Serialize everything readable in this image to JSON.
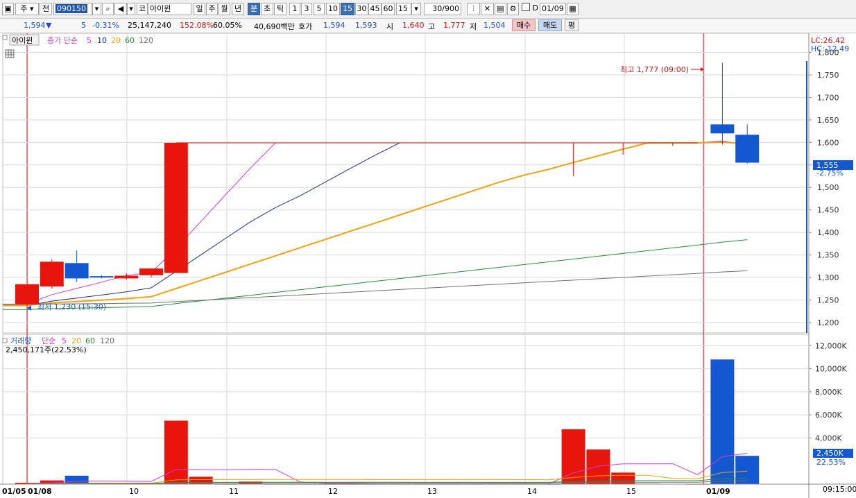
{
  "toolbar": {
    "market_type": "주",
    "market_arrow": "▾",
    "prev_label": "전",
    "stock_code": "090150",
    "dropdown_glyph": "▾",
    "market_tag": "코",
    "stock_name": "아이윈",
    "periods": [
      "일",
      "주",
      "월",
      "년",
      "분",
      "초",
      "틱"
    ],
    "active_period": "분",
    "intervals": [
      "1",
      "3",
      "5",
      "10",
      "15",
      "30",
      "45",
      "60"
    ],
    "active_interval": "15",
    "interval_select": "15",
    "count_value": "30",
    "count_total": "/900",
    "checkbox_label": "D",
    "date_value": "01/09",
    "icons": [
      "chart-type-icon",
      "search-icon",
      "speaker-icon",
      "candle-tool-icon",
      "eraser-tool-icon",
      "save-icon",
      "gear-icon",
      "calendar-icon"
    ]
  },
  "quote": {
    "price": "1,594",
    "down_arrow": "▼",
    "change": "5",
    "change_pct": "-0.31%",
    "volume": "25,147,240",
    "volume_ratio": "152.08%",
    "turnover_pct": "60.05%",
    "trade_value": "40,690백만",
    "bid_ask_label": "호가",
    "ask": "1,594",
    "bid": "1,593",
    "open_label": "시",
    "open": "1,640",
    "high_label": "고",
    "high": "1,777",
    "low_label": "저",
    "low": "1,504",
    "buy_label": "매수",
    "sell_label": "매도",
    "avg_label": "평"
  },
  "price_panel": {
    "name_tag": "아이윈",
    "legend_title": "종가 단순",
    "ma_labels": [
      "5",
      "10",
      "20",
      "60",
      "120"
    ],
    "lc_label": "LC:26.42",
    "hc_label": "HC:-12.49",
    "high_annotation": "최고 1,777 (09:00)",
    "low_annotation": "최저 1,230 (15:30)",
    "current_price_tag": "1,555",
    "current_pct_tag": "-2.75%",
    "y_ticks": [
      "1,800",
      "1,750",
      "1,700",
      "1,650",
      "1,600",
      "1,550",
      "1,500",
      "1,450",
      "1,400",
      "1,350",
      "1,300",
      "1,250",
      "1,200"
    ]
  },
  "volume_panel": {
    "title": "거래량",
    "legend_title": "단순",
    "ma_labels": [
      "5",
      "20",
      "60",
      "120"
    ],
    "volume_text": "2,450,171주(22.53%)",
    "y_ticks": [
      "12,000K",
      "10,000K",
      "8,000K",
      "6,000K",
      "4,000K"
    ],
    "current_tag": "2,450K",
    "current_pct": "22.53%"
  },
  "x_axis": {
    "labels": [
      "01/05",
      "01/08",
      "10",
      "11",
      "12",
      "13",
      "14",
      "15",
      "01/09"
    ],
    "time_label": "09:15:00"
  },
  "colors": {
    "up": "#e8150c",
    "down": "#1458d1",
    "ma5": "#d43ad0",
    "ma10": "#1b2e8c",
    "ma20": "#f0a30e",
    "ma60": "#2a8a3c",
    "ma120": "#6f6f6f",
    "grid": "#d9d9d9"
  },
  "chart_data": {
    "type": "candlestick",
    "candles": [
      {
        "o": 1240,
        "h": 1290,
        "l": 1235,
        "c": 1285
      },
      {
        "o": 1280,
        "h": 1340,
        "l": 1275,
        "c": 1335
      },
      {
        "o": 1332,
        "h": 1360,
        "l": 1290,
        "c": 1298
      },
      {
        "o": 1303,
        "h": 1305,
        "l": 1298,
        "c": 1300
      },
      {
        "o": 1298,
        "h": 1310,
        "l": 1295,
        "c": 1304
      },
      {
        "o": 1305,
        "h": 1320,
        "l": 1300,
        "c": 1320
      },
      {
        "o": 1310,
        "h": 1599,
        "l": 1310,
        "c": 1599
      },
      {
        "o": 1599,
        "h": 1599,
        "l": 1599,
        "c": 1599
      },
      {
        "o": 1599,
        "h": 1599,
        "l": 1599,
        "c": 1599
      },
      {
        "o": 1599,
        "h": 1599,
        "l": 1599,
        "c": 1599
      },
      {
        "o": 1599,
        "h": 1599,
        "l": 1599,
        "c": 1599
      },
      {
        "o": 1599,
        "h": 1599,
        "l": 1599,
        "c": 1599
      },
      {
        "o": 1599,
        "h": 1599,
        "l": 1599,
        "c": 1599
      },
      {
        "o": 1599,
        "h": 1599,
        "l": 1599,
        "c": 1599
      },
      {
        "o": 1599,
        "h": 1599,
        "l": 1599,
        "c": 1599
      },
      {
        "o": 1599,
        "h": 1599,
        "l": 1599,
        "c": 1599
      },
      {
        "o": 1599,
        "h": 1599,
        "l": 1599,
        "c": 1599
      },
      {
        "o": 1599,
        "h": 1599,
        "l": 1599,
        "c": 1599
      },
      {
        "o": 1599,
        "h": 1599,
        "l": 1599,
        "c": 1599
      },
      {
        "o": 1599,
        "h": 1599,
        "l": 1599,
        "c": 1599
      },
      {
        "o": 1599,
        "h": 1599,
        "l": 1599,
        "c": 1599
      },
      {
        "o": 1599,
        "h": 1599,
        "l": 1599,
        "c": 1599
      },
      {
        "o": 1599,
        "h": 1599,
        "l": 1525,
        "c": 1599
      },
      {
        "o": 1599,
        "h": 1599,
        "l": 1599,
        "c": 1599
      },
      {
        "o": 1599,
        "h": 1599,
        "l": 1573,
        "c": 1599
      },
      {
        "o": 1599,
        "h": 1599,
        "l": 1599,
        "c": 1599
      },
      {
        "o": 1599,
        "h": 1599,
        "l": 1592,
        "c": 1599
      },
      {
        "o": 1599,
        "h": 1599,
        "l": 1599,
        "c": 1599
      },
      {
        "o": 1640,
        "h": 1777,
        "l": 1595,
        "c": 1620
      },
      {
        "o": 1617,
        "h": 1640,
        "l": 1553,
        "c": 1555
      }
    ],
    "volume_k": [
      120,
      320,
      730,
      40,
      30,
      60,
      5500,
      640,
      20,
      220,
      20,
      20,
      20,
      20,
      20,
      20,
      20,
      20,
      20,
      20,
      20,
      20,
      4750,
      3000,
      1000,
      40,
      30,
      20,
      10800,
      2450
    ],
    "ma_endpoints_note": "moving averages drawn from the candle closes",
    "y_range": [
      1180,
      1830
    ],
    "volume_range_k": [
      0,
      12500
    ]
  }
}
